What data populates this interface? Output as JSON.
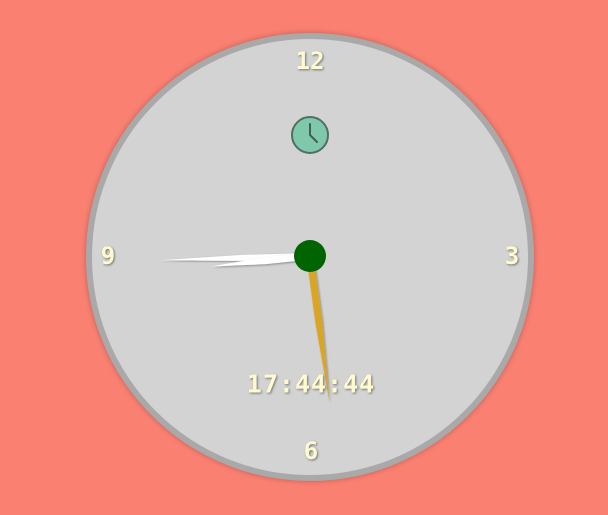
{
  "clock": {
    "numerals": {
      "twelve": "12",
      "three": "3",
      "six": "6",
      "nine": "9"
    },
    "digital_time": "17:44:44",
    "time": {
      "hours": 17,
      "minutes": 44,
      "seconds": 44
    },
    "mini_icon": "clock-icon"
  },
  "colors": {
    "background": "#fa8072",
    "face": "#d3d3d3",
    "rim": "#a9a9a9",
    "numerals": "#fffacd",
    "hub": "#006400",
    "hour_hand": "#daa520",
    "minute_hand": "#ffffff",
    "second_hand": "#ffffff",
    "mini_icon_fill": "#7fc8a9"
  }
}
